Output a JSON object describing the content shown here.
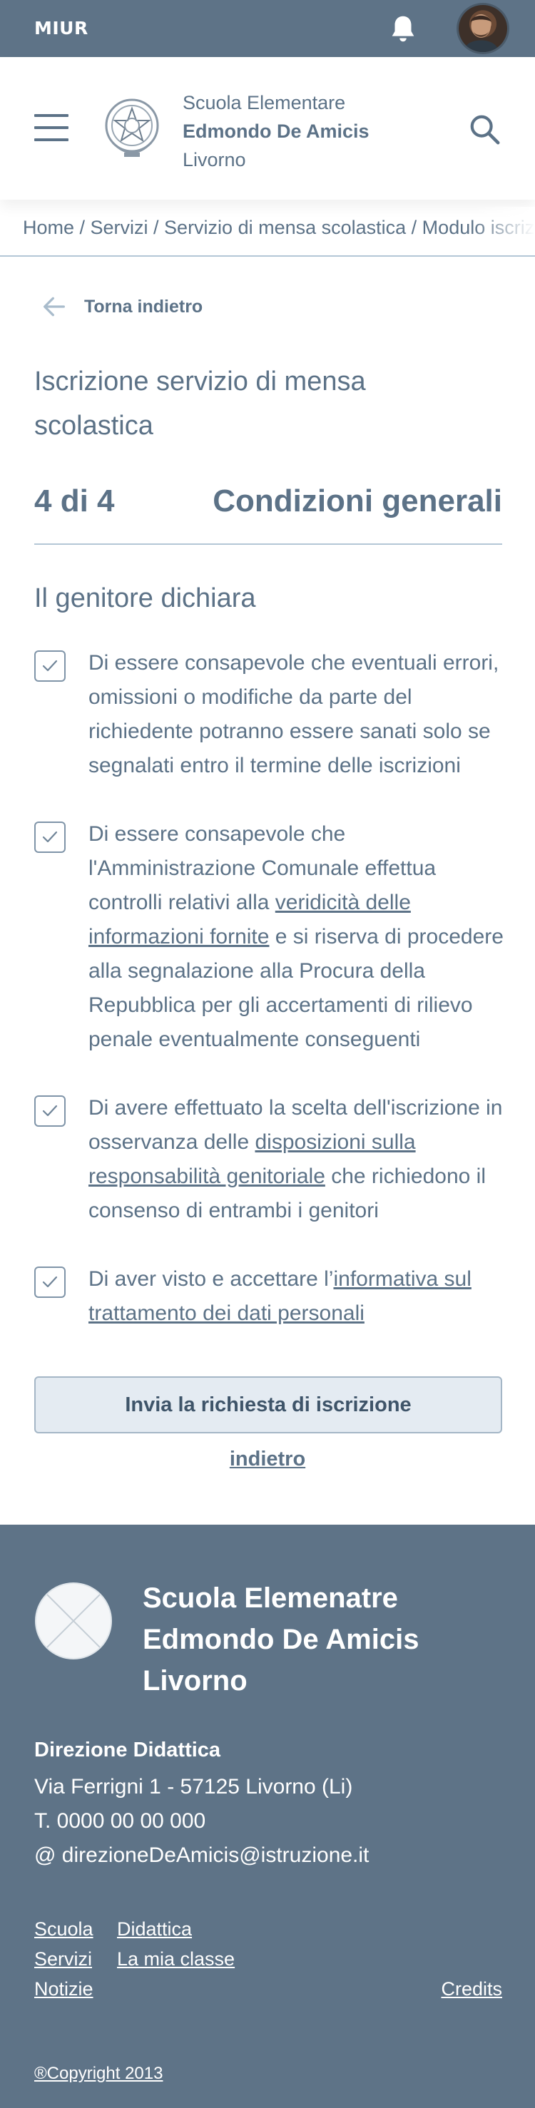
{
  "topbar": {
    "brand": "MIUR",
    "bell_icon": "bell-icon",
    "avatar": "user-avatar"
  },
  "header": {
    "menu_icon": "hamburger-menu-icon",
    "emblem": "italian-republic-emblem",
    "school_line1": "Scuola Elementare",
    "school_line2": "Edmondo De Amicis",
    "school_line3": "Livorno",
    "search_icon": "search-icon"
  },
  "breadcrumb": {
    "items": [
      "Home",
      "Servizi",
      "Servizio di mensa scolastica",
      "Modulo iscrizione"
    ],
    "text": "Home / Servizi / Servizio di mensa scolastica / Modulo iscrizione"
  },
  "back": {
    "label": "Torna indietro",
    "icon": "arrow-left-icon"
  },
  "page": {
    "title": "Iscrizione servizio di mensa scolastica",
    "step_count": "4 di 4",
    "step_title": "Condizioni generali",
    "section_title": "Il genitore dichiara"
  },
  "declarations": [
    {
      "checked": true,
      "text_before": "Di essere consapevole che eventuali errori, omissioni o modifiche da parte del richiedente potranno essere sanati solo se segnalati entro il termine delle iscrizioni",
      "link": "",
      "text_after": ""
    },
    {
      "checked": true,
      "text_before": "Di essere consapevole che l'Amministrazione Comunale effettua controlli relativi alla ",
      "link": "veridicità delle informazioni fornite",
      "text_after": " e si riserva di procedere alla segnalazione alla Procura della Repubblica per gli accertamenti di rilievo penale eventualmente conseguenti"
    },
    {
      "checked": true,
      "text_before": "Di avere effettuato la scelta dell'iscrizione in osservanza delle ",
      "link": "disposizioni sulla responsabilità genitoriale",
      "text_after": " che richiedono il consenso di entrambi i genitori"
    },
    {
      "checked": true,
      "text_before": "Di aver visto e accettare l’",
      "link": "informativa sul trattamento dei dati personali",
      "text_after": ""
    }
  ],
  "actions": {
    "submit_label": "Invia la richiesta di iscrizione",
    "back_label": "indietro"
  },
  "footer": {
    "name_line1": "Scuola Elemenatre",
    "name_line2": "Edmondo De Amicis",
    "name_line3": "Livorno",
    "direction_title": "Direzione Didattica",
    "address": "Via Ferrigni 1 - 57125 Livorno (Li)",
    "phone": "T. 0000 00 00 000",
    "email": "@ direzioneDeAmicis@istruzione.it",
    "links": {
      "scuola": "Scuola",
      "didattica": "Didattica",
      "servizi": "Servizi",
      "la_mia_classe": "La mia classe",
      "notizie": "Notizie",
      "credits": "Credits"
    },
    "copyright": "®Copyright 2013"
  },
  "colors": {
    "primary": "#5e7387",
    "text": "#5c7287",
    "divider": "#b3c7d6",
    "button_bg": "#e4ebf2"
  }
}
